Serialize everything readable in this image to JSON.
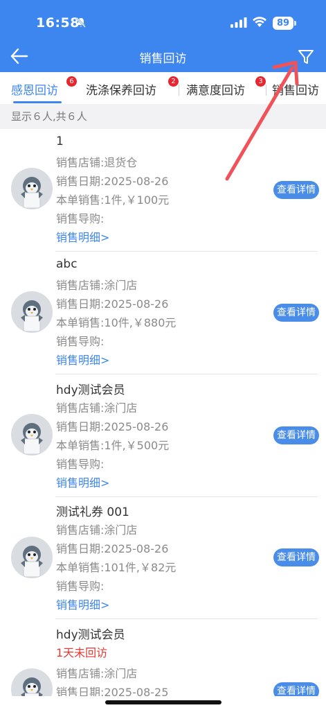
{
  "status_bar": {
    "time": "16:58",
    "battery": "89"
  },
  "header": {
    "title": "销售回访"
  },
  "tabs": [
    {
      "label": "感恩回访",
      "badge": "6"
    },
    {
      "label": "洗涤保养回访",
      "badge": "2"
    },
    {
      "label": "满意度回访",
      "badge": "3"
    },
    {
      "label": "销售回访",
      "badge": ""
    }
  ],
  "summary": "显示６人,共６人",
  "records": [
    {
      "name": "1",
      "warning": "",
      "store": "销售店铺:退货仓",
      "date": "销售日期:2025-08-26",
      "sales": "本单销售:1件,￥100元",
      "guide": "销售导购:",
      "link": "销售明细>",
      "button": "查看详情"
    },
    {
      "name": "abc",
      "warning": "",
      "store": "销售店铺:涂门店",
      "date": "销售日期:2025-08-26",
      "sales": "本单销售:10件,￥880元",
      "guide": "销售导购:",
      "link": "销售明细>",
      "button": "查看详情"
    },
    {
      "name": "hdy测试会员",
      "warning": "",
      "store": "销售店铺:涂门店",
      "date": "销售日期:2025-08-26",
      "sales": "本单销售:1件,￥500元",
      "guide": "销售导购:",
      "link": "销售明细>",
      "button": "查看详情"
    },
    {
      "name": "测试礼券 001",
      "warning": "",
      "store": "销售店铺:涂门店",
      "date": "销售日期:2025-08-26",
      "sales": "本单销售:101件,￥82元",
      "guide": "销售导购:",
      "link": "销售明细>",
      "button": "查看详情"
    },
    {
      "name": "hdy测试会员",
      "warning": "1天未回访",
      "store": "销售店铺:涂门店",
      "date": "销售日期:2025-08-25",
      "sales": "",
      "guide": "",
      "link": "",
      "button": "查看详情"
    }
  ],
  "colors": {
    "primary": "#3d86f0",
    "warning": "#e53935",
    "badge": "#e8262e",
    "annotation_arrow": "#f0525a"
  },
  "icons": {
    "back": "back-arrow-icon",
    "filter": "filter-icon",
    "avatar": "penguin-avatar-icon"
  }
}
